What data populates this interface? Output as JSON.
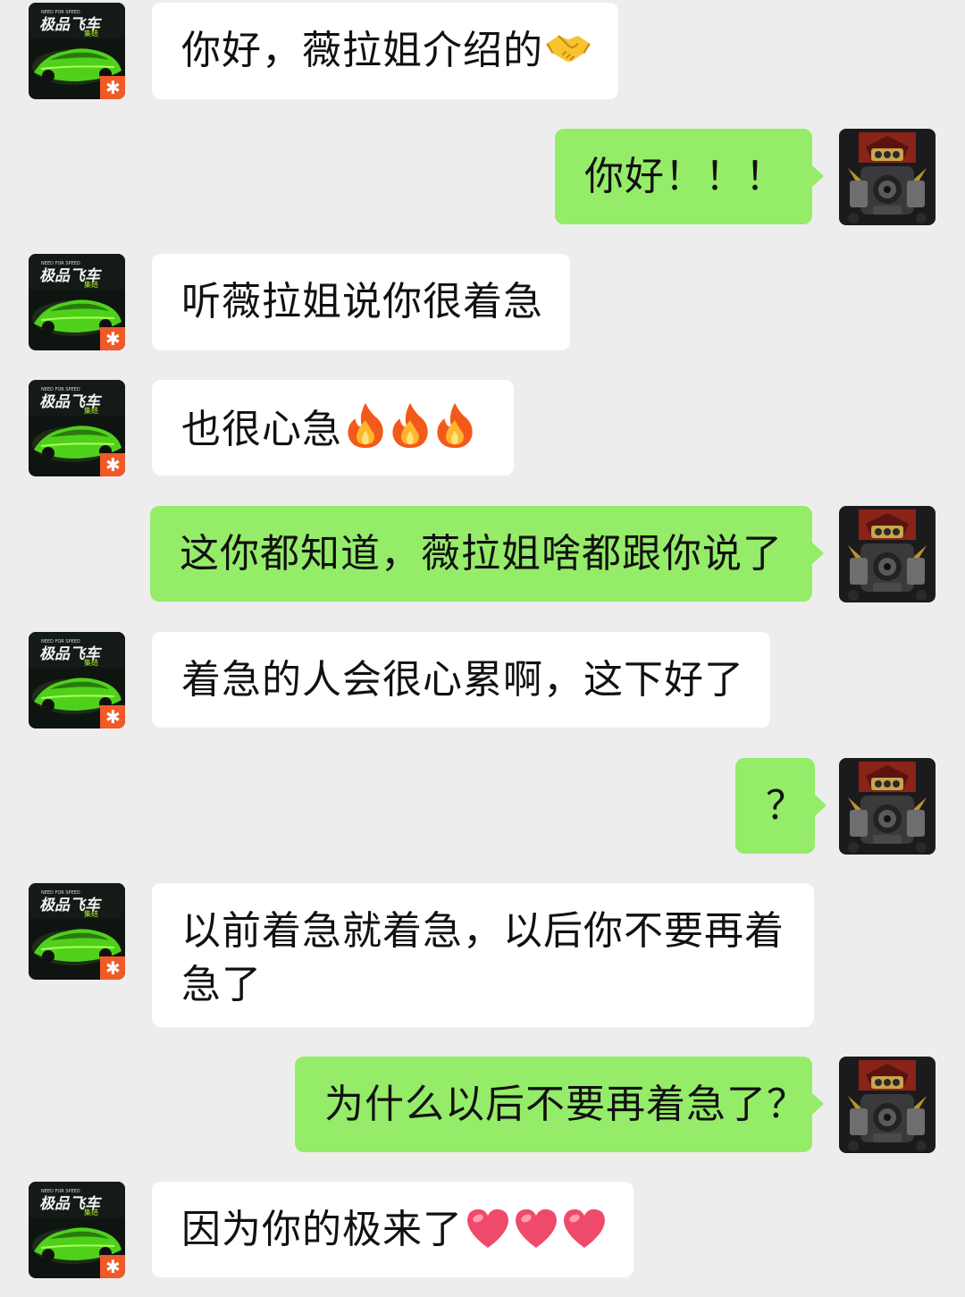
{
  "messages": [
    {
      "side": "in",
      "text": "你好，薇拉姐介绍的",
      "emoji": [
        "handshake"
      ]
    },
    {
      "side": "out",
      "text": "你好！！！",
      "emoji": []
    },
    {
      "side": "in",
      "text": "听薇拉姐说你很着急",
      "emoji": []
    },
    {
      "side": "in",
      "text": "也很心急",
      "emoji": [
        "fire",
        "fire",
        "fire"
      ]
    },
    {
      "side": "out",
      "text": "这你都知道，薇拉姐啥都跟你说了",
      "emoji": []
    },
    {
      "side": "in",
      "text": "着急的人会很心累啊，这下好了",
      "emoji": []
    },
    {
      "side": "out",
      "text": "？",
      "emoji": []
    },
    {
      "side": "in",
      "text": "以前着急就着急，以后你不要再着急了",
      "emoji": []
    },
    {
      "side": "out",
      "text": "为什么以后不要再着急了？",
      "emoji": []
    },
    {
      "side": "in",
      "text": "因为你的极来了",
      "emoji": [
        "heart",
        "heart",
        "heart"
      ]
    }
  ],
  "avatars": {
    "left": {
      "icon": "need-for-speed-avatar",
      "caption": "极品飞车"
    },
    "right": {
      "icon": "engine-avatar"
    }
  },
  "colors": {
    "background": "#ededed",
    "incoming_bubble": "#ffffff",
    "outgoing_bubble": "#95ec69"
  }
}
